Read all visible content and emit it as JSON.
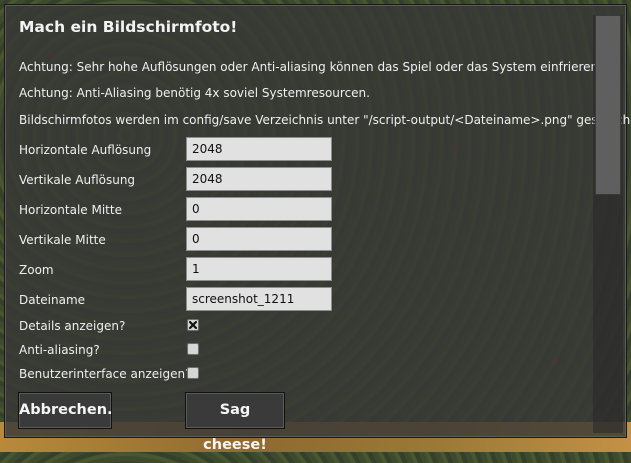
{
  "dialog": {
    "title": "Mach ein Bildschirmfoto!",
    "notes": [
      "Achtung: Sehr hohe Auflösungen oder Anti-aliasing können das Spiel oder das System einfrieren.",
      "Achtung: Anti-Aliasing benötig 4x soviel Systemresourcen.",
      "Bildschirmfotos werden im config/save Verzeichnis unter \"/script-output/<Dateiname>.png\" gespeichert."
    ],
    "fields": [
      {
        "label": "Horizontale Auflösung",
        "value": "2048"
      },
      {
        "label": "Vertikale Auflösung",
        "value": "2048"
      },
      {
        "label": "Horizontale Mitte",
        "value": "0"
      },
      {
        "label": "Vertikale Mitte",
        "value": "0"
      },
      {
        "label": "Zoom",
        "value": "1"
      },
      {
        "label": "Dateiname",
        "value": "screenshot_1211"
      }
    ],
    "checkboxes": [
      {
        "label": "Details anzeigen?",
        "checked": true
      },
      {
        "label": "Anti-aliasing?",
        "checked": false
      },
      {
        "label": "Benutzerinterface anzeigen?",
        "checked": false
      }
    ],
    "buttons": {
      "cancel": "Abbrechen.",
      "confirm": "Sag cheese!"
    }
  }
}
